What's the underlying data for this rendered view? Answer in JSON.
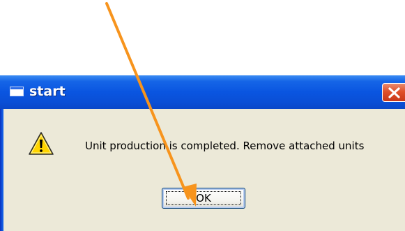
{
  "window": {
    "title": "start",
    "icon": "window-icon"
  },
  "title_bar_buttons": {
    "close_icon": "close-icon"
  },
  "message": {
    "icon": "warning-icon",
    "text": "Unit production is completed. Remove attached units"
  },
  "buttons": {
    "ok_label": "OK"
  },
  "annotation": {
    "type": "arrow",
    "color": "#f7941d"
  },
  "colors": {
    "title_bar": "#0a55e0",
    "dialog_body": "#ece9d8",
    "close_button": "#e0502a",
    "warning": "#ffd400"
  }
}
